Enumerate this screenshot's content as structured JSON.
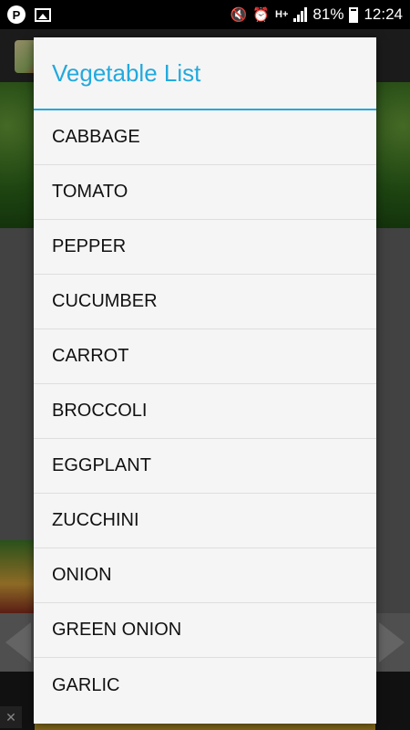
{
  "status_bar": {
    "battery": "81%",
    "time": "12:24",
    "network": "H+"
  },
  "dialog": {
    "title": "Vegetable List",
    "items": [
      "CABBAGE",
      "TOMATO",
      "PEPPER",
      "CUCUMBER",
      "CARROT",
      "BROCCOLI",
      "EGGPLANT",
      "ZUCCHINI",
      "ONION",
      "GREEN ONION",
      "GARLIC"
    ]
  },
  "colors": {
    "accent": "#23a9dd",
    "dialog_bg": "#f5f5f5"
  }
}
